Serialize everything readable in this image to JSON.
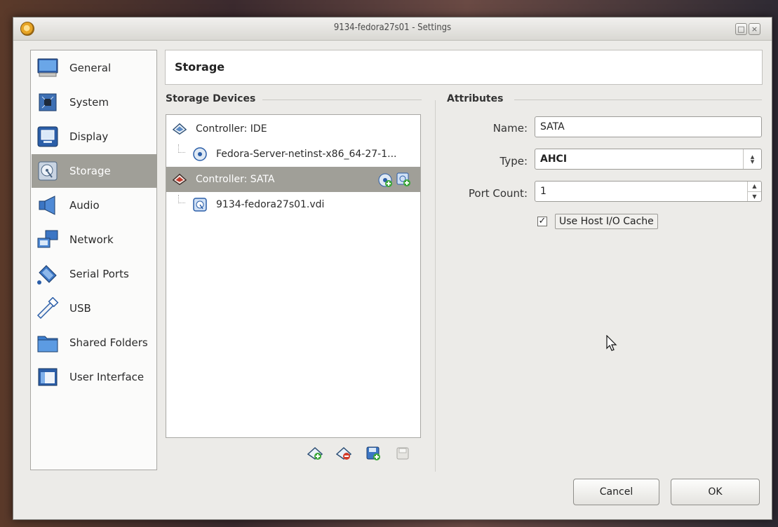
{
  "window": {
    "title": "9134-fedora27s01 - Settings"
  },
  "sidebar": {
    "items": [
      {
        "label": "General",
        "icon": "monitor-icon"
      },
      {
        "label": "System",
        "icon": "chip-icon"
      },
      {
        "label": "Display",
        "icon": "display-icon"
      },
      {
        "label": "Storage",
        "icon": "disk-icon",
        "active": true
      },
      {
        "label": "Audio",
        "icon": "speaker-icon"
      },
      {
        "label": "Network",
        "icon": "network-icon"
      },
      {
        "label": "Serial Ports",
        "icon": "serial-port-icon"
      },
      {
        "label": "USB",
        "icon": "usb-icon"
      },
      {
        "label": "Shared Folders",
        "icon": "folder-icon"
      },
      {
        "label": "User Interface",
        "icon": "window-icon"
      }
    ]
  },
  "header": {
    "title": "Storage"
  },
  "storage_devices": {
    "title": "Storage Devices",
    "tree": [
      {
        "label": "Controller: IDE",
        "icon": "controller-icon",
        "level": 0
      },
      {
        "label": "Fedora-Server-netinst-x86_64-27-1...",
        "icon": "optical-disc-icon",
        "level": 1
      },
      {
        "label": "Controller: SATA",
        "icon": "controller-icon",
        "level": 0,
        "selected": true
      },
      {
        "label": "9134-fedora27s01.vdi",
        "icon": "hard-disk-icon",
        "level": 1
      }
    ]
  },
  "attributes": {
    "title": "Attributes",
    "name_label": "Name:",
    "name_value": "SATA",
    "type_label": "Type:",
    "type_value": "AHCI",
    "port_count_label": "Port Count:",
    "port_count_value": "1",
    "host_io_cache_label": "Use Host I/O Cache",
    "host_io_cache_checked": true
  },
  "buttons": {
    "cancel": "Cancel",
    "ok": "OK"
  },
  "colors": {
    "selection": "#a09f98",
    "window_bg": "#ecebe8"
  }
}
